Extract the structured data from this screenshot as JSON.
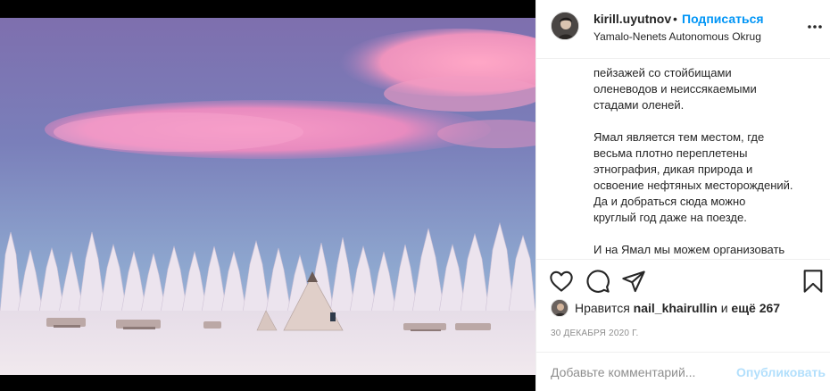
{
  "post": {
    "username": "kirill.uyutnov",
    "separator": "•",
    "follow_label": "Подписаться",
    "location": "Yamalo-Nenets Autonomous Okrug",
    "more_icon": "more-options-icon"
  },
  "caption": {
    "lines": [
      "пейзажей со стойбищами",
      "оленеводов и неиссякаемыми",
      "стадами оленей.",
      "Ямал является тем местом, где",
      "весьма плотно переплетены",
      "этнография, дикая природа и",
      "освоение нефтяных месторождений.",
      "Да и добраться сюда можно",
      "круглый год даже на поезде.",
      "И на Ямал мы можем организовать"
    ]
  },
  "actions": {
    "icons": [
      "heart-icon",
      "comment-icon",
      "share-icon",
      "bookmark-icon"
    ]
  },
  "likes": {
    "prefix": "Нравится",
    "user": "nail_khairullin",
    "middle": "и",
    "count_text": "ещё 267"
  },
  "date": "30 ДЕКАБРЯ 2020 Г.",
  "comment": {
    "placeholder": "Добавьте комментарий...",
    "post_label": "Опубликовать"
  },
  "colors": {
    "accent": "#0095f6",
    "post_disabled": "#b2dffc",
    "muted": "#8e8e8e",
    "border": "#efefef"
  }
}
